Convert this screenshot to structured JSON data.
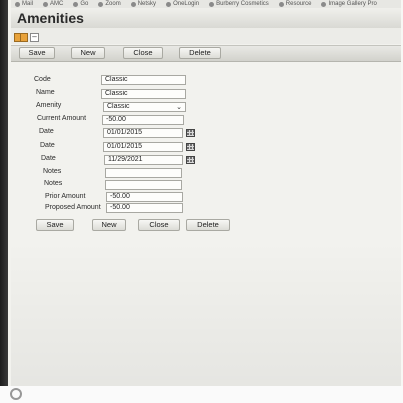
{
  "bookmarks": [
    "Mail",
    "AMC",
    "Go",
    "Zoom",
    "Netsky",
    "OneLogin",
    "Burberry Cosmetics",
    "Resource",
    "Image Gallery Pro"
  ],
  "window": {
    "title": "Amenities"
  },
  "toolbar": {
    "save": "Save",
    "new": "New",
    "close": "Close",
    "delete": "Delete"
  },
  "form": {
    "code": {
      "label": "Code",
      "value": "Classic"
    },
    "name": {
      "label": "Name",
      "value": "Classic"
    },
    "amenity": {
      "label": "Amenity",
      "value": "Classic"
    },
    "current_amount": {
      "label": "Current Amount",
      "value": "-50.00"
    },
    "date1": {
      "label": "Date",
      "value": "01/01/2015"
    },
    "date2": {
      "label": "Date",
      "value": "01/01/2015"
    },
    "date3": {
      "label": "Date",
      "value": "11/29/2021"
    },
    "notes1": {
      "label": "Notes",
      "value": ""
    },
    "notes2": {
      "label": "Notes",
      "value": ""
    },
    "prior_amount": {
      "label": "Prior Amount",
      "value": "-50.00"
    },
    "proposed_amount": {
      "label": "Proposed Amount",
      "value": "-50.00"
    }
  },
  "bottom_toolbar": {
    "save": "Save",
    "new": "New",
    "close": "Close",
    "delete": "Delete"
  },
  "icons": {
    "view": "grid-view-icon",
    "collapse": "minus-icon",
    "calendar": "calendar-icon",
    "select": "chevron-down-icon",
    "corner": "refresh-icon"
  }
}
